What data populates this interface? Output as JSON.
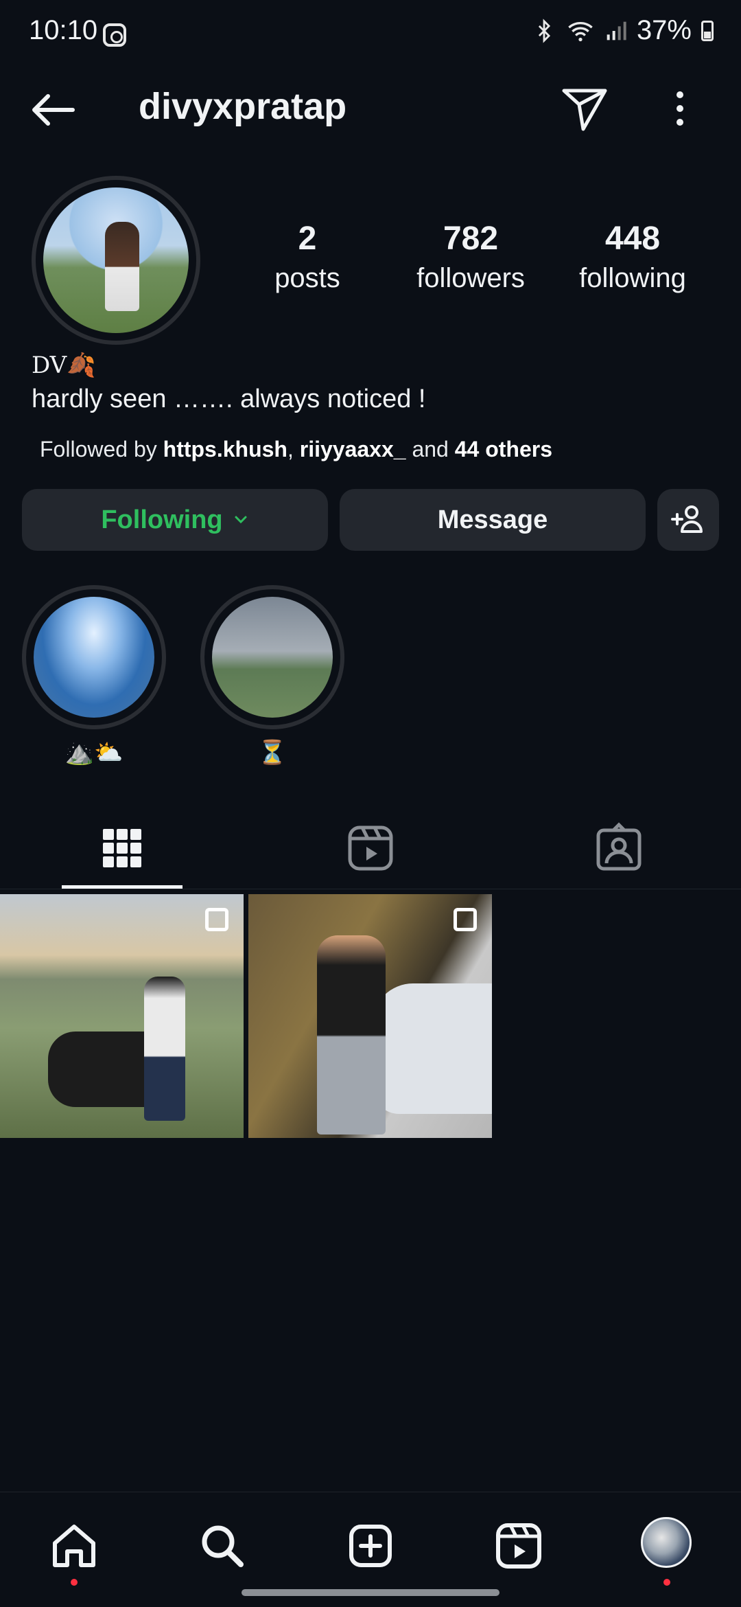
{
  "status_bar": {
    "time": "10:10",
    "battery": "37%"
  },
  "header": {
    "username": "divyxpratap"
  },
  "profile": {
    "stats": [
      {
        "value": "2",
        "label": "posts"
      },
      {
        "value": "782",
        "label": "followers"
      },
      {
        "value": "448",
        "label": "following"
      }
    ],
    "bio_name": "DV🍂",
    "bio_text": "hardly seen ……. always noticed !",
    "followed_by": {
      "prefix": "Followed by ",
      "user1": "https.khush",
      "sep": ", ",
      "user2": "riiyyaaxx_",
      "middle": " and ",
      "others": "44 others"
    }
  },
  "actions": {
    "following_label": "Following",
    "message_label": "Message"
  },
  "highlights": [
    {
      "label": "⛰️⛅"
    },
    {
      "label": "⏳"
    }
  ],
  "tabs": [
    "grid-icon",
    "reels-icon",
    "tagged-icon"
  ],
  "posts": [
    "post-1",
    "post-2"
  ],
  "colors": {
    "background": "#0b0f16",
    "button_bg": "#23272e",
    "following_green": "#2fbf5f",
    "notification_red": "#ff3040"
  },
  "bottom_nav": [
    "home-icon",
    "search-icon",
    "create-icon",
    "reels-icon",
    "profile-avatar"
  ]
}
